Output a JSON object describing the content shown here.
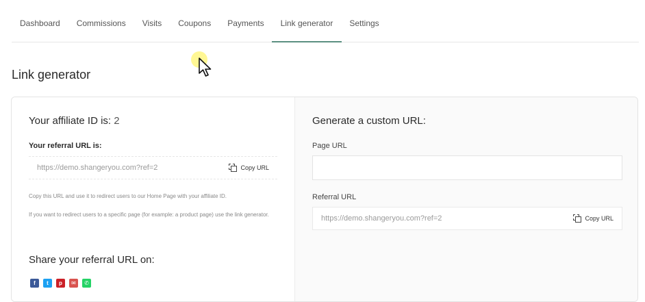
{
  "tabs": [
    {
      "label": "Dashboard"
    },
    {
      "label": "Commissions"
    },
    {
      "label": "Visits"
    },
    {
      "label": "Coupons"
    },
    {
      "label": "Payments"
    },
    {
      "label": "Link generator",
      "active": true
    },
    {
      "label": "Settings"
    }
  ],
  "page_title": "Link generator",
  "left": {
    "affiliate_label": "Your affiliate ID is:",
    "affiliate_id": "2",
    "referral_label": "Your referral URL is:",
    "referral_url": "https://demo.shangeryou.com?ref=2",
    "copy_label": "Copy URL",
    "note_1": "Copy this URL and use it to redirect users to our Home Page with your affiliate ID.",
    "note_2": "If you want to redirect users to a specific page (for example: a product page) use the link generator.",
    "share_title": "Share your referral URL on:",
    "share_icons": [
      {
        "name": "facebook-icon",
        "glyph": "f",
        "color": "#3b5998"
      },
      {
        "name": "twitter-icon",
        "glyph": "t",
        "color": "#1da1f2"
      },
      {
        "name": "pinterest-icon",
        "glyph": "p",
        "color": "#cb2027"
      },
      {
        "name": "email-icon",
        "glyph": "✉",
        "color": "#d9534f"
      },
      {
        "name": "whatsapp-icon",
        "glyph": "✆",
        "color": "#25d366"
      }
    ]
  },
  "right": {
    "title": "Generate a custom URL:",
    "page_url_label": "Page URL",
    "page_url_value": "",
    "referral_url_label": "Referral URL",
    "referral_url": "https://demo.shangeryou.com?ref=2",
    "copy_label": "Copy URL"
  }
}
